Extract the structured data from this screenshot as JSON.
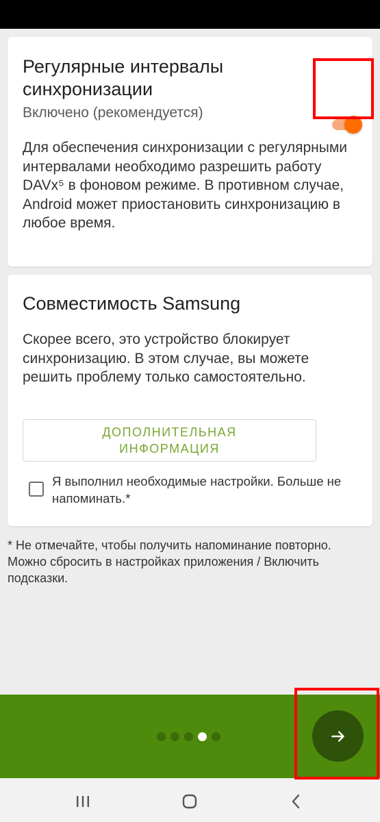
{
  "sync_card": {
    "title": "Регулярные интервалы синхронизации",
    "subtitle": "Включено (рекомендуется)",
    "body": "Для обеспечения синхронизации с регулярными интервалами необходимо разрешить работу DAVx⁵ в фоновом режиме. В противном случае, Android может приостановить синхронизацию в любое время.",
    "toggle_on": true,
    "toggle_color": "#ff6d00"
  },
  "samsung_card": {
    "title": "Совместимость Samsung",
    "body": "Скорее всего, это устройство блокирует синхронизацию. В этом случае, вы можете решить проблему только самостоятельно.",
    "info_button_label": "ДОПОЛНИТЕЛЬНАЯ ИНФОРМАЦИЯ",
    "checkbox_label": "Я выполнил необходимые настройки. Больше не напоминать.*",
    "checkbox_checked": false
  },
  "footnote": "* Не отмечайте, чтобы получить напоминание повторно. Можно сбросить в настройках приложения / Включить подсказки.",
  "pager": {
    "total_pages": 5,
    "current_page": 4,
    "next_icon": "arrow-right-icon"
  },
  "colors": {
    "accent_green": "#4e8a0c",
    "fab_green": "#2e520a",
    "highlight_red": "#ff0000"
  },
  "system_nav": {
    "icons": [
      "recent-apps-icon",
      "home-icon",
      "back-icon"
    ]
  }
}
